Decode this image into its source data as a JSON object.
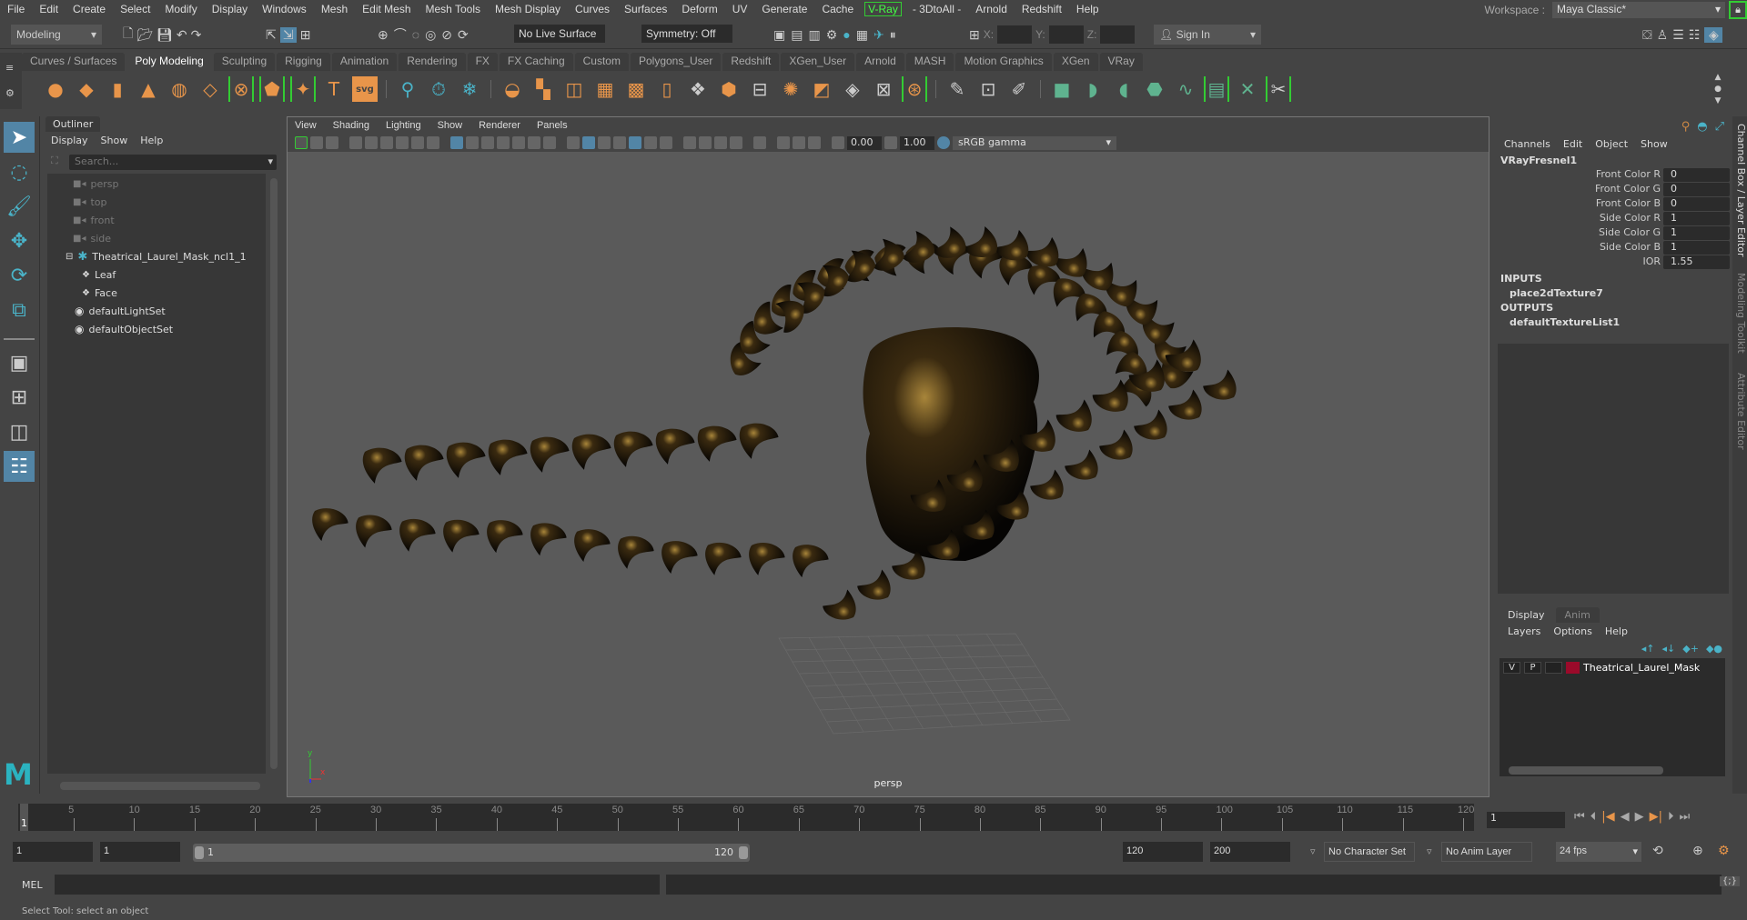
{
  "menubar": {
    "items": [
      "File",
      "Edit",
      "Create",
      "Select",
      "Modify",
      "Display",
      "Windows",
      "Mesh",
      "Edit Mesh",
      "Mesh Tools",
      "Mesh Display",
      "Curves",
      "Surfaces",
      "Deform",
      "UV",
      "Generate",
      "Cache",
      "V-Ray",
      "- 3DtoAll -",
      "Arnold",
      "Redshift",
      "Help"
    ]
  },
  "workspace": {
    "label": "Workspace :",
    "value": "Maya Classic*"
  },
  "statusline": {
    "mode": "Modeling",
    "live_surface": "No Live Surface",
    "symmetry": "Symmetry: Off",
    "x_label": "X:",
    "y_label": "Y:",
    "z_label": "Z:",
    "sign_in": "Sign In"
  },
  "shelf": {
    "tabs": [
      "Curves / Surfaces",
      "Poly Modeling",
      "Sculpting",
      "Rigging",
      "Animation",
      "Rendering",
      "FX",
      "FX Caching",
      "Custom",
      "Polygons_User",
      "Redshift",
      "XGen_User",
      "Arnold",
      "MASH",
      "Motion Graphics",
      "XGen",
      "VRay"
    ],
    "active_tab": "Poly Modeling"
  },
  "outliner": {
    "title": "Outliner",
    "menu": [
      "Display",
      "Show",
      "Help"
    ],
    "search_placeholder": "Search...",
    "items": [
      {
        "label": "persp",
        "type": "camera",
        "dim": true
      },
      {
        "label": "top",
        "type": "camera",
        "dim": true
      },
      {
        "label": "front",
        "type": "camera",
        "dim": true
      },
      {
        "label": "side",
        "type": "camera",
        "dim": true
      },
      {
        "label": "Theatrical_Laurel_Mask_ncl1_1",
        "type": "group",
        "expanded": true
      },
      {
        "label": "Leaf",
        "type": "mesh",
        "child": true
      },
      {
        "label": "Face",
        "type": "mesh",
        "child": true
      },
      {
        "label": "defaultLightSet",
        "type": "set"
      },
      {
        "label": "defaultObjectSet",
        "type": "set"
      }
    ]
  },
  "viewport": {
    "menu": [
      "View",
      "Shading",
      "Lighting",
      "Show",
      "Renderer",
      "Panels"
    ],
    "exposure": "0.00",
    "gamma": "1.00",
    "color_space": "sRGB gamma",
    "camera_label": "persp",
    "axis": {
      "x": "x",
      "y": "y",
      "z": "z"
    }
  },
  "channel_box": {
    "menu": [
      "Channels",
      "Edit",
      "Object",
      "Show"
    ],
    "node": "VRayFresnel1",
    "attributes": [
      {
        "name": "Front Color R",
        "value": "0"
      },
      {
        "name": "Front Color G",
        "value": "0"
      },
      {
        "name": "Front Color B",
        "value": "0"
      },
      {
        "name": "Side Color R",
        "value": "1"
      },
      {
        "name": "Side Color G",
        "value": "1"
      },
      {
        "name": "Side Color B",
        "value": "1"
      },
      {
        "name": "IOR",
        "value": "1.55"
      }
    ],
    "inputs_label": "INPUTS",
    "inputs": [
      "place2dTexture7"
    ],
    "outputs_label": "OUTPUTS",
    "outputs": [
      "defaultTextureList1"
    ]
  },
  "layer_editor": {
    "tabs": [
      "Display",
      "Anim"
    ],
    "active_tab": "Display",
    "menu": [
      "Layers",
      "Options",
      "Help"
    ],
    "layers": [
      {
        "v": "V",
        "p": "P",
        "name": "Theatrical_Laurel_Mask",
        "color": "#9b0a2a"
      }
    ]
  },
  "side_tabs": [
    "Channel Box / Layer Editor",
    "Modeling Toolkit",
    "Attribute Editor"
  ],
  "timeline": {
    "ticks": [
      "5",
      "10",
      "15",
      "20",
      "25",
      "30",
      "35",
      "40",
      "45",
      "50",
      "55",
      "60",
      "65",
      "70",
      "75",
      "80",
      "85",
      "90",
      "95",
      "100",
      "105",
      "110",
      "115",
      "120"
    ],
    "current_frame": "1",
    "current_frame_field": "1"
  },
  "range": {
    "start": "1",
    "playback_start": "1",
    "slider_start": "1",
    "slider_end": "120",
    "playback_end": "120",
    "end": "200",
    "character_set": "No Character Set",
    "anim_layer": "No Anim Layer",
    "fps": "24 fps"
  },
  "cmdline": {
    "label": "MEL"
  },
  "helpline": {
    "text": "Select Tool: select an object"
  },
  "colors": {
    "accent": "#5285a6",
    "shelf_orange": "#e8954a",
    "shelf_green": "#5fb38f",
    "highlight_green": "#33cc33",
    "layer_color": "#9b0a2a"
  }
}
